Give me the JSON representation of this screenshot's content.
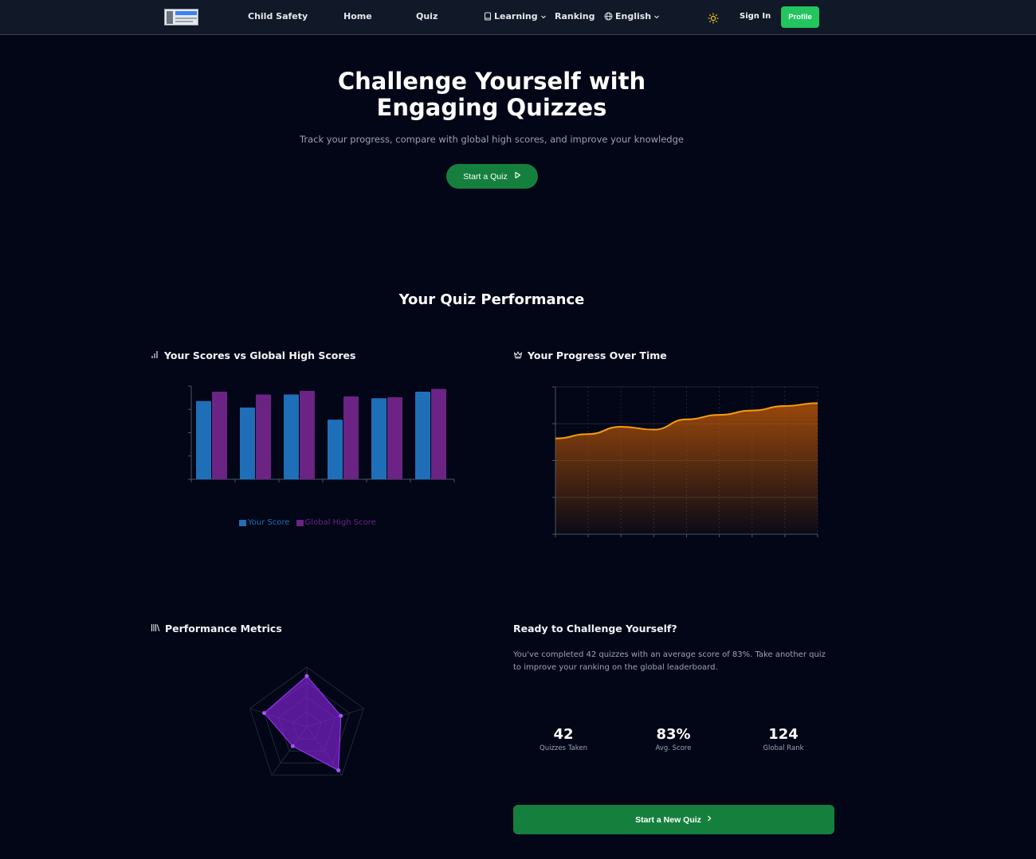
{
  "nav": {
    "logo_text": "OLABS",
    "links": [
      "Child Safety",
      "Home",
      "Quiz"
    ],
    "learning": "Learning",
    "ranking": "Ranking",
    "language": "English",
    "sign_in": "Sign In",
    "profile": "Profile"
  },
  "hero": {
    "title": "Challenge Yourself with Engaging Quizzes",
    "subtitle": "Track your progress, compare with global high scores, and improve your knowledge",
    "cta": "Start a Quiz"
  },
  "performance": {
    "title": "Your Quiz Performance",
    "scores_title": "Your Scores vs Global High Scores",
    "progress_title": "Your Progress Over Time",
    "metrics_title": "Performance Metrics"
  },
  "cta_card": {
    "title": "Ready to Challenge Yourself?",
    "text": "You've completed 42 quizzes with an average score of 83%. Take another quiz to improve your ranking on the global leaderboard.",
    "stats": [
      {
        "value": "42",
        "label": "Quizzes Taken"
      },
      {
        "value": "83%",
        "label": "Avg. Score"
      },
      {
        "value": "124",
        "label": "Global Rank"
      }
    ],
    "button": "Start a New Quiz"
  },
  "colors": {
    "your_score": "#1f6fb8",
    "global_high": "#6b2384",
    "progress_line": "#f59e0b",
    "radar": "#7e22ce",
    "green": "#15803d"
  },
  "chart_data": [
    {
      "type": "bar",
      "categories": [
        "",
        "",
        "",
        "",
        "",
        ""
      ],
      "series": [
        {
          "name": "Your Score",
          "values": [
            84,
            77,
            91,
            64,
            87,
            94
          ]
        },
        {
          "name": "Global High Score",
          "values": [
            94,
            91,
            95,
            89,
            88,
            97
          ]
        }
      ],
      "ylim": [
        0,
        100
      ],
      "grid": false,
      "legend": "bottom"
    },
    {
      "type": "area",
      "x": [
        0,
        1,
        2,
        3,
        4,
        5,
        6,
        7,
        8
      ],
      "values": [
        65,
        68,
        73,
        71,
        78,
        81,
        84,
        87,
        89
      ],
      "ylim": [
        0,
        100
      ],
      "grid": true
    },
    {
      "type": "radar",
      "categories": [
        "",
        "",
        "",
        "",
        ""
      ],
      "values": [
        85,
        60,
        90,
        40,
        75
      ],
      "rlim": [
        0,
        100
      ]
    }
  ]
}
